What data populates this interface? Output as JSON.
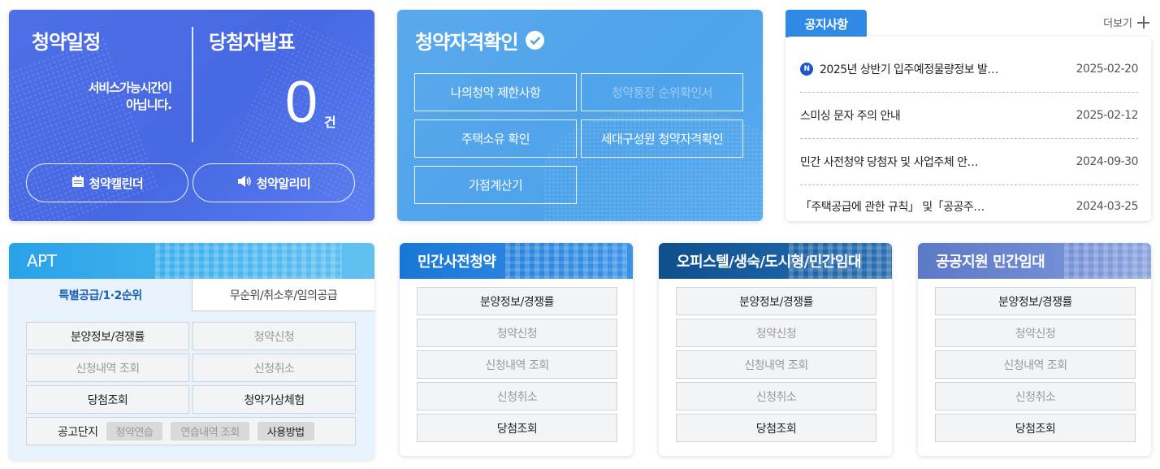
{
  "schedule_card": {
    "title_schedule": "청약일정",
    "title_winners": "당첨자발표",
    "service_msg_line1": "서비스가능시간이",
    "service_msg_line2": "아닙니다.",
    "winner_count": "0",
    "winner_unit": "건",
    "calendar_button": "청약캘린더",
    "alert_button": "청약알리미"
  },
  "eligibility_card": {
    "title": "청약자격확인",
    "buttons": [
      "나의청약 제한사항",
      "청약통장 순위확인서",
      "주택소유 확인",
      "세대구성원 청약자격확인",
      "가점계산기"
    ]
  },
  "notice": {
    "tab_label": "공지사항",
    "more_label": "더보기",
    "items": [
      {
        "badge": "N",
        "title": "2025년 상반기 입주예정물량정보 발…",
        "date": "2025-02-20"
      },
      {
        "title": "스미싱 문자 주의 안내",
        "date": "2025-02-12"
      },
      {
        "title": "민간 사전청약 당첨자 및 사업주체 안…",
        "date": "2024-09-30"
      },
      {
        "title": "「주택공급에 관한 규칙」 및「공공주…",
        "date": "2024-03-25"
      }
    ]
  },
  "apt": {
    "title": "APT",
    "tab_active": "특별공급/1·2순위",
    "tab_inactive": "무순위/취소후/임의공급",
    "buttons": [
      "분양정보/경쟁률",
      "청약신청",
      "신청내역 조회",
      "신청취소",
      "당첨조회",
      "청약가상체험"
    ],
    "notice_complex_label": "공고단지",
    "chips": [
      "청약연습",
      "연습내역 조회",
      "사용방법"
    ]
  },
  "private_pre": {
    "title": "민간사전청약",
    "buttons": [
      "분양정보/경쟁률",
      "청약신청",
      "신청내역 조회",
      "신청취소",
      "당첨조회"
    ]
  },
  "officetel": {
    "title": "오피스텔/생숙/도시형/민간임대",
    "buttons": [
      "분양정보/경쟁률",
      "청약신청",
      "신청내역 조회",
      "신청취소",
      "당첨조회"
    ]
  },
  "public_rental": {
    "title": "공공지원 민간임대",
    "buttons": [
      "분양정보/경쟁률",
      "청약신청",
      "신청내역 조회",
      "신청취소",
      "당첨조회"
    ]
  },
  "icons": [
    "calendar-icon",
    "speaker-icon",
    "check-circle-icon",
    "plus-icon",
    "new-badge-icon"
  ],
  "colors": {
    "schedule_bg": "#4a6be4",
    "eligibility_bg": "#51a5eb",
    "notice_tab": "#2f8ae6",
    "apt_header": "#3aaeeb",
    "private_header": "#2281dc",
    "officetel_header": "#155a9c",
    "public_header": "#6f8bd4",
    "apt_active_tab_text": "#1b5fb0"
  }
}
